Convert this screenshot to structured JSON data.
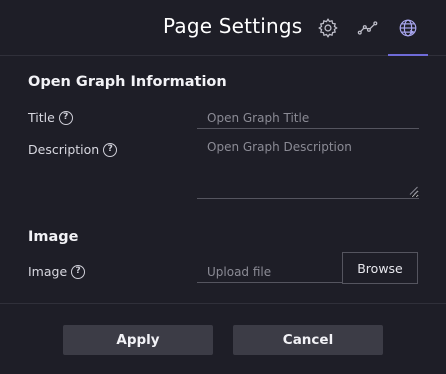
{
  "header": {
    "title": "Page Settings",
    "icons": [
      "gear-icon",
      "analytics-icon",
      "globe-icon"
    ],
    "active_tab": "globe-icon"
  },
  "open_graph": {
    "section_title": "Open Graph Information",
    "title_label": "Title",
    "title_placeholder": "Open Graph Title",
    "description_label": "Description",
    "description_placeholder": "Open Graph Description"
  },
  "image": {
    "section_title": "Image",
    "label": "Image",
    "placeholder": "Upload file",
    "browse_label": "Browse"
  },
  "help_glyph": "?",
  "footer": {
    "apply_label": "Apply",
    "cancel_label": "Cancel"
  },
  "colors": {
    "background": "#1e1e27",
    "accent": "#6f6bd8",
    "button": "#3c3c46"
  }
}
